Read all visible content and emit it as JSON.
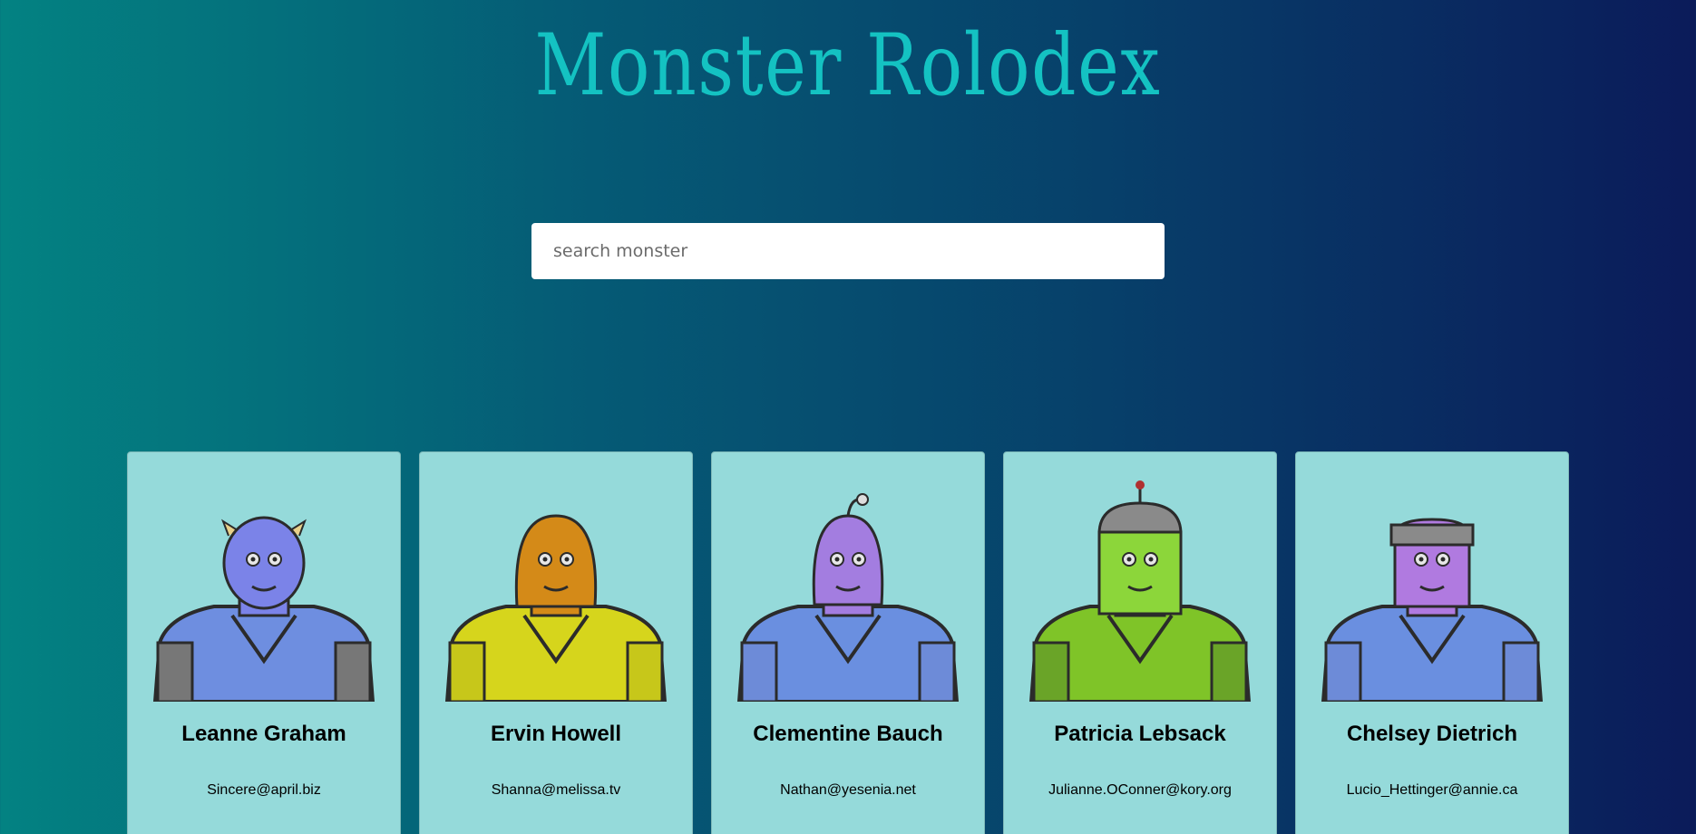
{
  "header": {
    "title": "Monster Rolodex"
  },
  "search": {
    "placeholder": "search monster",
    "value": ""
  },
  "monsters": [
    {
      "name": "Leanne Graham",
      "email": "Sincere@april.biz",
      "avatar_icon": "horned-blue-monster-icon",
      "skin": "#7b83e8",
      "body": "#6e8ee0",
      "shoulder": "#777"
    },
    {
      "name": "Ervin Howell",
      "email": "Shanna@melissa.tv",
      "avatar_icon": "orange-helmet-monster-icon",
      "skin": "#d48a18",
      "body": "#d6d51c",
      "shoulder": "#c7c71a"
    },
    {
      "name": "Clementine Bauch",
      "email": "Nathan@yesenia.net",
      "avatar_icon": "purple-cyclops-monster-icon",
      "skin": "#a37de0",
      "body": "#6a8fe0",
      "shoulder": "#6d8bd8"
    },
    {
      "name": "Patricia Lebsack",
      "email": "Julianne.OConner@kory.org",
      "avatar_icon": "green-robot-monster-icon",
      "skin": "#8cd63a",
      "body": "#7fc428",
      "shoulder": "#6aa428"
    },
    {
      "name": "Chelsey Dietrich",
      "email": "Lucio_Hettinger@annie.ca",
      "avatar_icon": "purple-cyborg-monster-icon",
      "skin": "#b07ae0",
      "body": "#6a8fe0",
      "shoulder": "#6d8bd8"
    }
  ]
}
